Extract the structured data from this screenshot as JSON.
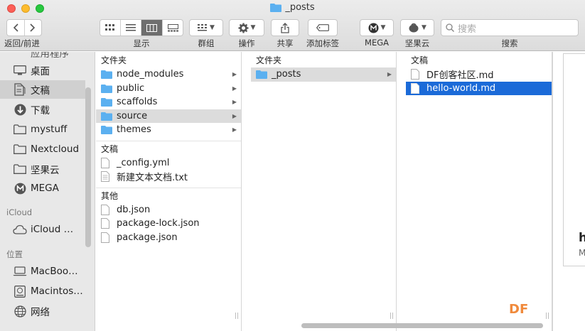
{
  "window": {
    "title": "_posts"
  },
  "toolbar": {
    "nav_label": "返回/前进",
    "view_label": "显示",
    "group_label": "群组",
    "action_label": "操作",
    "share_label": "共享",
    "tag_label": "添加标签",
    "mega_label": "MEGA",
    "nutstore_label": "坚果云",
    "search_label": "搜索",
    "search_placeholder": "搜索"
  },
  "sidebar": {
    "cut_off_item": "应用程序",
    "favorites": [
      {
        "label": "桌面",
        "icon": "desktop-icon"
      },
      {
        "label": "文稿",
        "icon": "documents-icon",
        "selected": true
      },
      {
        "label": "下载",
        "icon": "download-icon"
      },
      {
        "label": "mystuff",
        "icon": "folder-icon"
      },
      {
        "label": "Nextcloud",
        "icon": "folder-icon"
      },
      {
        "label": "坚果云",
        "icon": "folder-icon"
      },
      {
        "label": "MEGA",
        "icon": "mega-icon"
      }
    ],
    "icloud_head": "iCloud",
    "icloud_items": [
      {
        "label": "iCloud …",
        "icon": "cloud-icon"
      }
    ],
    "locations_head": "位置",
    "locations": [
      {
        "label": "MacBoo…",
        "icon": "laptop-icon"
      },
      {
        "label": "Macintos…",
        "icon": "disk-icon"
      },
      {
        "label": "网络",
        "icon": "network-icon"
      }
    ]
  },
  "columns": {
    "col1": {
      "folder_head": "文件夹",
      "folders": [
        "node_modules",
        "public",
        "scaffolds",
        "source",
        "themes"
      ],
      "selected_folder": "source",
      "docs_head": "文稿",
      "docs": [
        "_config.yml",
        "新建文本文档.txt"
      ],
      "other_head": "其他",
      "others": [
        "db.json",
        "package-lock.json",
        "package.json"
      ]
    },
    "col2": {
      "folder_head": "文件夹",
      "folders": [
        "_posts"
      ],
      "selected_folder": "_posts"
    },
    "col3": {
      "docs_head": "文稿",
      "docs": [
        "DF创客社区.md",
        "hello-world.md"
      ],
      "selected_doc": "hello-world.md"
    }
  },
  "preview": {
    "heading": "h",
    "meta": "M"
  },
  "watermark": "DF",
  "colors": {
    "selection_blue": "#1b6ad8",
    "folder_blue": "#5bb0f0"
  }
}
